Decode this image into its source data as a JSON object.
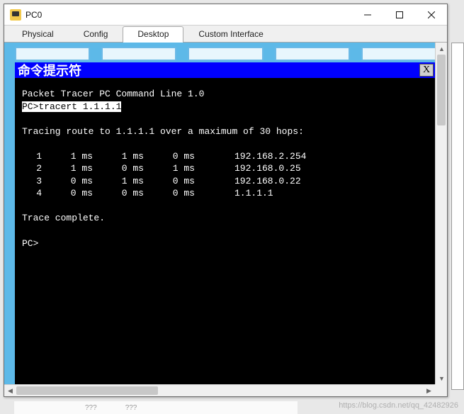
{
  "window": {
    "title": "PC0",
    "tabs": [
      "Physical",
      "Config",
      "Desktop",
      "Custom Interface"
    ],
    "active_tab": 2
  },
  "terminal": {
    "title": "命令提示符",
    "close_label": "X",
    "header": "Packet Tracer PC Command Line 1.0",
    "prompt": "PC>",
    "command": "tracert 1.1.1.1",
    "tracing_line": "Tracing route to 1.1.1.1 over a maximum of 30 hops:",
    "hops": [
      {
        "n": "1",
        "t1": "1 ms",
        "t2": "1 ms",
        "t3": "0 ms",
        "addr": "192.168.2.254"
      },
      {
        "n": "2",
        "t1": "1 ms",
        "t2": "0 ms",
        "t3": "1 ms",
        "addr": "192.168.0.25"
      },
      {
        "n": "3",
        "t1": "0 ms",
        "t2": "1 ms",
        "t3": "0 ms",
        "addr": "192.168.0.22"
      },
      {
        "n": "4",
        "t1": "0 ms",
        "t2": "0 ms",
        "t3": "0 ms",
        "addr": "1.1.1.1"
      }
    ],
    "complete": "Trace complete.",
    "final_prompt": "PC>"
  },
  "watermark": "https://blog.csdn.net/qq_42482926"
}
